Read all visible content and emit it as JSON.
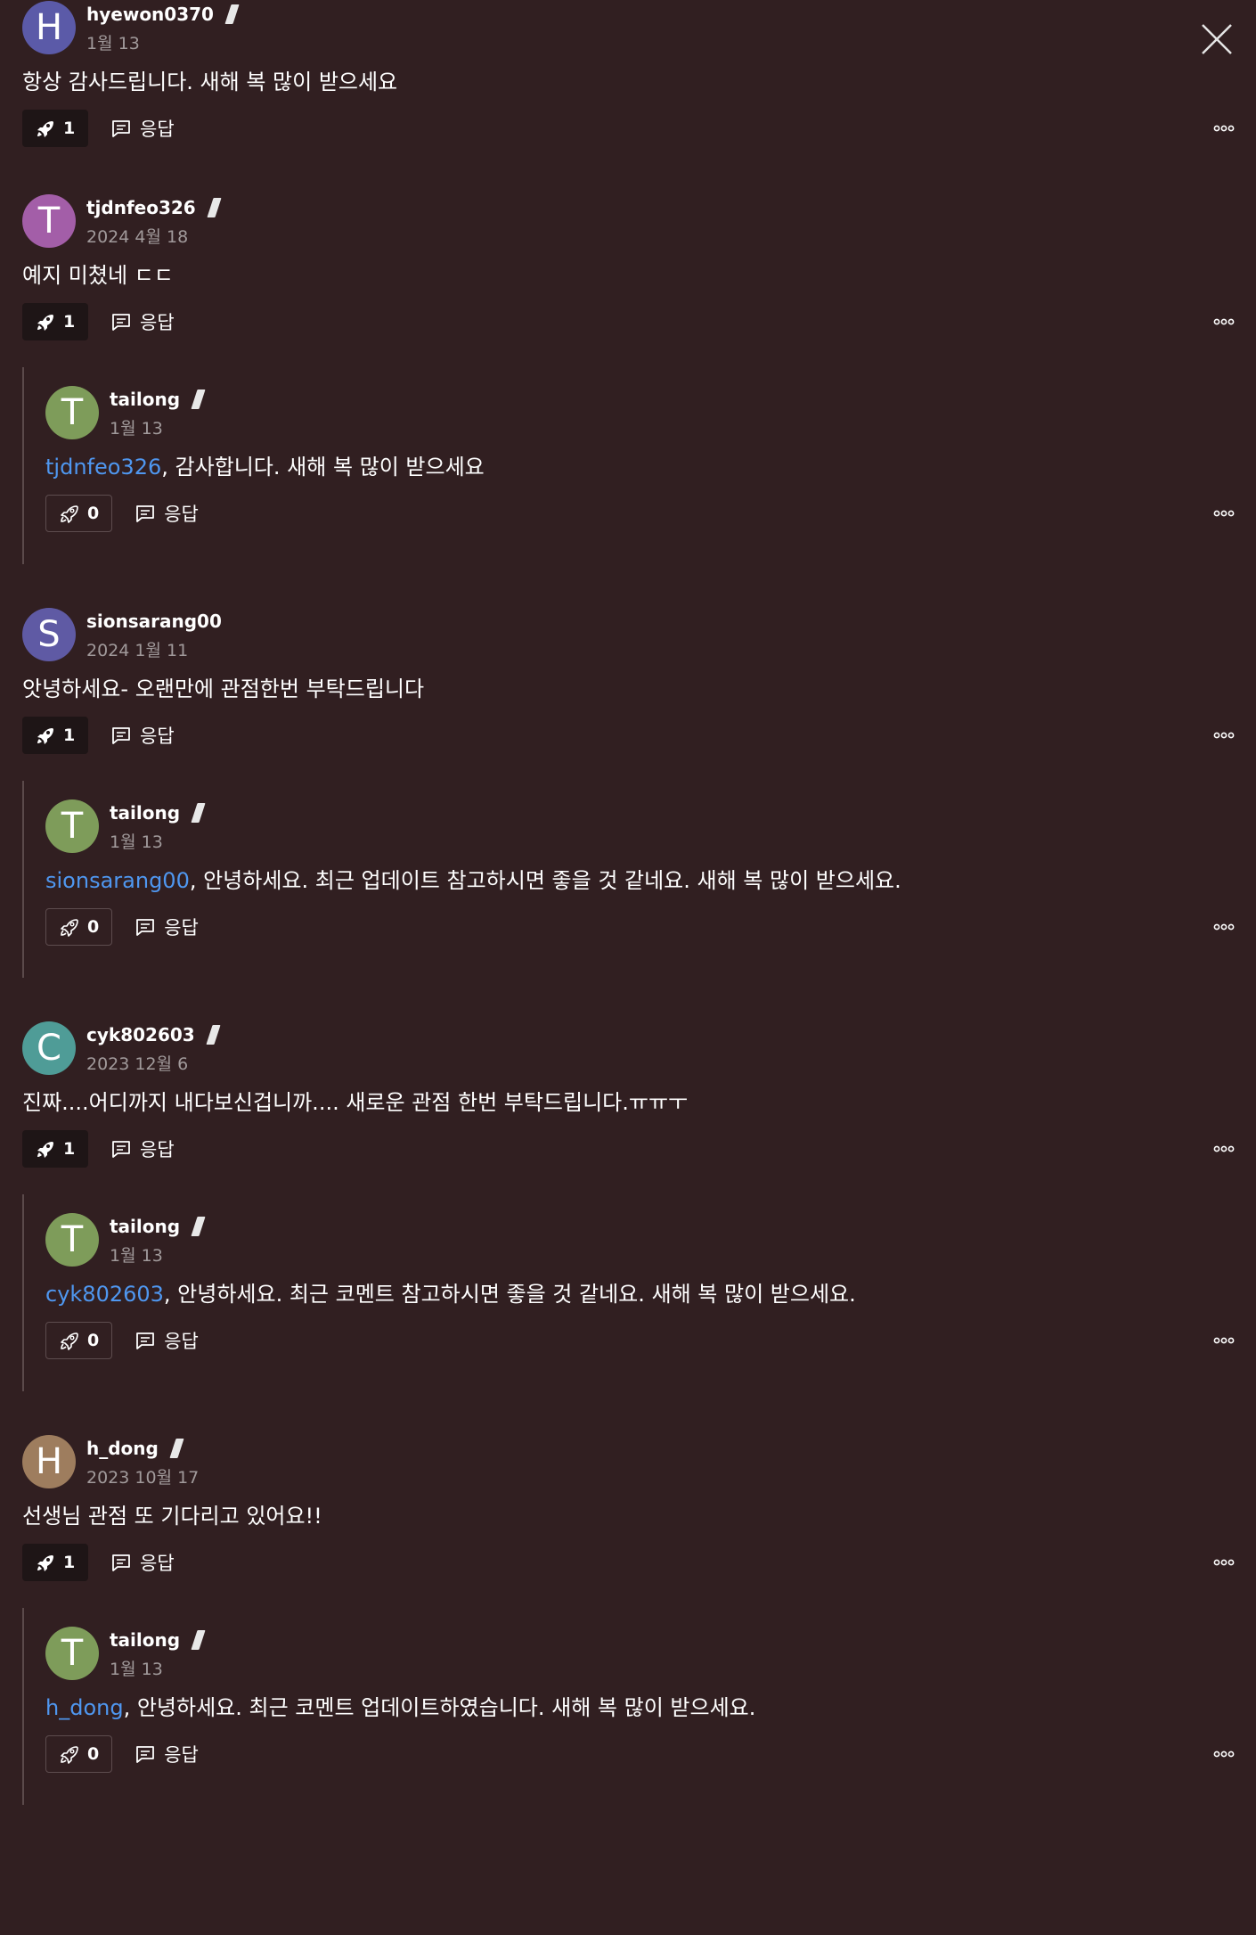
{
  "ui": {
    "reply_label": "응답"
  },
  "threads": [
    {
      "comment": {
        "initial": "H",
        "avatar_color": "#5b5aa8",
        "username": "hyewon0370",
        "date": "1월 13",
        "mention": "",
        "text": "항상 감사드립니다. 새해 복 많이 받으세요",
        "boost_count": "1",
        "boosted": true
      },
      "replies": []
    },
    {
      "comment": {
        "initial": "T",
        "avatar_color": "#a35ea8",
        "username": "tjdnfeo326",
        "date": "2024 4월 18",
        "mention": "",
        "text": "예지 미쳤네 ㄷㄷ",
        "boost_count": "1",
        "boosted": true
      },
      "replies": [
        {
          "initial": "T",
          "avatar_color": "#7e9c5a",
          "username": "tailong",
          "date": "1월 13",
          "mention": "tjdnfeo326",
          "text": ", 감사합니다. 새해 복 많이 받으세요",
          "boost_count": "0",
          "boosted": false
        }
      ]
    },
    {
      "comment": {
        "initial": "S",
        "avatar_color": "#5f5aa4",
        "username": "sionsarang00",
        "date": "2024 1월 11",
        "mention": "",
        "text": "앗녕하세요- 오랜만에 관점한번 부탁드립니다",
        "boost_count": "1",
        "boosted": true,
        "no_badge": true
      },
      "replies": [
        {
          "initial": "T",
          "avatar_color": "#7e9c5a",
          "username": "tailong",
          "date": "1월 13",
          "mention": "sionsarang00",
          "text": ", 안녕하세요. 최근 업데이트 참고하시면 좋을 것 같네요. 새해 복 많이 받으세요.",
          "boost_count": "0",
          "boosted": false
        }
      ]
    },
    {
      "comment": {
        "initial": "C",
        "avatar_color": "#4f9c97",
        "username": "cyk802603",
        "date": "2023 12월 6",
        "mention": "",
        "text": "진짜....어디까지 내다보신겁니까.... 새로운 관점 한번 부탁드립니다.ㅠㅠㅜ",
        "boost_count": "1",
        "boosted": true
      },
      "replies": [
        {
          "initial": "T",
          "avatar_color": "#7e9c5a",
          "username": "tailong",
          "date": "1월 13",
          "mention": "cyk802603",
          "text": ", 안녕하세요. 최근 코멘트 참고하시면 좋을 것 같네요. 새해 복 많이 받으세요.",
          "boost_count": "0",
          "boosted": false
        }
      ]
    },
    {
      "comment": {
        "initial": "H",
        "avatar_color": "#9e7d5e",
        "username": "h_dong",
        "date": "2023 10월 17",
        "mention": "",
        "text": "선생님 관점 또 기다리고 있어요!!",
        "boost_count": "1",
        "boosted": true
      },
      "replies": [
        {
          "initial": "T",
          "avatar_color": "#7e9c5a",
          "username": "tailong",
          "date": "1월 13",
          "mention": "h_dong",
          "text": ", 안녕하세요. 최근 코멘트 업데이트하였습니다. 새해 복 많이 받으세요.",
          "boost_count": "0",
          "boosted": false
        }
      ]
    }
  ]
}
